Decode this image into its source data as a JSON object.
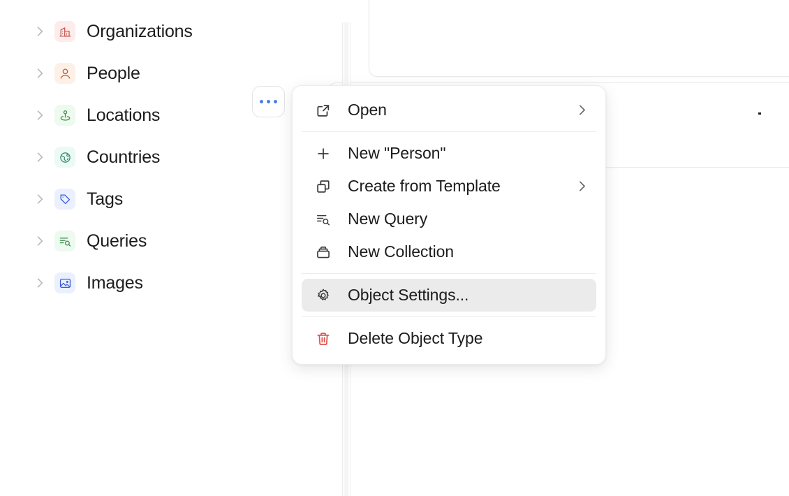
{
  "sidebar": {
    "items": [
      {
        "label": "",
        "icon": "generic-icon",
        "icon_color": "#d4635d",
        "chip_color": "#fdeeec",
        "clipped": true
      },
      {
        "label": "Organizations",
        "icon": "building-icon",
        "icon_color": "#c94b42",
        "chip_color": "#fdeceb",
        "clipped": false
      },
      {
        "label": "People",
        "icon": "person-icon",
        "icon_color": "#c7562b",
        "chip_color": "#fdf1e7",
        "clipped": false
      },
      {
        "label": "Locations",
        "icon": "map-pin-icon",
        "icon_color": "#3f8f4b",
        "chip_color": "#edfaef",
        "clipped": false
      },
      {
        "label": "Countries",
        "icon": "globe-icon",
        "icon_color": "#2e8471",
        "chip_color": "#ebfaf3",
        "clipped": false
      },
      {
        "label": "Tags",
        "icon": "tag-icon",
        "icon_color": "#3959d9",
        "chip_color": "#eaf0fe",
        "clipped": false
      },
      {
        "label": "Queries",
        "icon": "query-search-icon",
        "icon_color": "#3f8f4b",
        "chip_color": "#edfaef",
        "clipped": false
      },
      {
        "label": "Images",
        "icon": "image-icon",
        "icon_color": "#3959d9",
        "chip_color": "#eaf0fe",
        "clipped": false
      }
    ],
    "expand_icon": "chevron-right-icon"
  },
  "more_button": {
    "name": "more-options-button",
    "icon": "ellipsis-icon",
    "dot_color": "#4a7dea"
  },
  "context_menu": {
    "groups": [
      {
        "items": [
          {
            "label": "Open",
            "icon": "external-link-icon",
            "submenu": true,
            "selected": false,
            "danger": false
          }
        ]
      },
      {
        "items": [
          {
            "label": "New \"Person\"",
            "icon": "plus-icon",
            "submenu": false,
            "selected": false,
            "danger": false
          },
          {
            "label": "Create from Template",
            "icon": "copy-icon",
            "submenu": true,
            "selected": false,
            "danger": false
          },
          {
            "label": "New Query",
            "icon": "query-search-icon",
            "submenu": false,
            "selected": false,
            "danger": false
          },
          {
            "label": "New Collection",
            "icon": "collection-box-icon",
            "submenu": false,
            "selected": false,
            "danger": false
          }
        ]
      },
      {
        "items": [
          {
            "label": "Object Settings...",
            "icon": "gear-icon",
            "submenu": false,
            "selected": true,
            "danger": false
          }
        ]
      },
      {
        "items": [
          {
            "label": "Delete Object Type",
            "icon": "trash-icon",
            "submenu": false,
            "selected": false,
            "danger": true
          }
        ]
      }
    ],
    "submenu_icon": "chevron-right-icon",
    "danger_color": "#e1534d",
    "highlight_color": "#ebebeb"
  }
}
